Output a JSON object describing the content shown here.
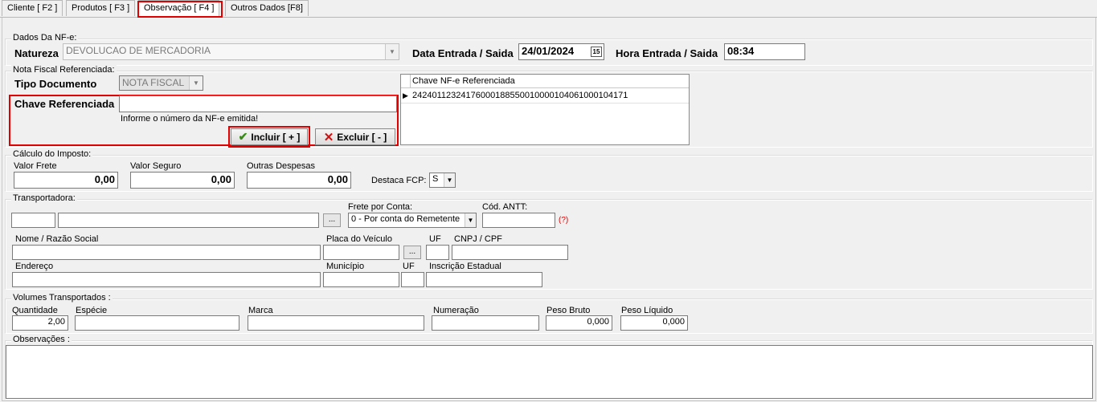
{
  "tabs": [
    {
      "label": "Cliente [ F2 ]"
    },
    {
      "label": "Produtos [ F3 ]"
    },
    {
      "label": "Observação [ F4 ]"
    },
    {
      "label": "Outros Dados [F8]"
    }
  ],
  "nfe": {
    "section_title": "Dados Da NF-e:",
    "natureza_label": "Natureza",
    "natureza_value": "DEVOLUCAO DE MERCADORIA",
    "data_label": "Data Entrada / Saida",
    "data_value": "24/01/2024",
    "calendar_glyph": "15",
    "hora_label": "Hora Entrada / Saida",
    "hora_value": "08:34"
  },
  "ref": {
    "section_title": "Nota Fiscal Referenciada:",
    "tipo_label": "Tipo Documento",
    "tipo_value": "NOTA FISCAL",
    "chave_label": "Chave Referenciada",
    "chave_value": "",
    "hint": "Informe o número da NF-e emitida!",
    "incluir_label": "Incluir [ + ]",
    "excluir_label": "Excluir [ - ]",
    "grid_header": "Chave NF-e Referenciada",
    "grid_rows": [
      "24240112324176000188550010000104061000104171"
    ]
  },
  "imposto": {
    "section_title": "Cálculo do Imposto:",
    "frete_label": "Valor Frete",
    "frete_value": "0,00",
    "seguro_label": "Valor Seguro",
    "seguro_value": "0,00",
    "outras_label": "Outras Despesas",
    "outras_value": "0,00",
    "fcp_label": "Destaca FCP:",
    "fcp_value": "S"
  },
  "transp": {
    "section_title": "Transportadora:",
    "codigo_value": "",
    "nome_value": "",
    "search_btn": "...",
    "frete_label": "Frete por Conta:",
    "frete_value": "0 - Por conta do Remetente",
    "antt_label": "Cód. ANTT:",
    "antt_value": "",
    "antt_help": "(?)",
    "razao_label": "Nome / Razão Social",
    "placa_label": "Placa do Veículo",
    "placa_btn": "...",
    "uf_label": "UF",
    "cnpj_label": "CNPJ / CPF",
    "endereco_label": "Endereço",
    "municipio_label": "Município",
    "uf2_label": "UF",
    "ie_label": "Inscrição Estadual"
  },
  "volumes": {
    "section_title": "Volumes Transportados :",
    "qtd_label": "Quantidade",
    "qtd_value": "2,00",
    "especie_label": "Espécie",
    "marca_label": "Marca",
    "numeracao_label": "Numeração",
    "peso_bruto_label": "Peso Bruto",
    "peso_bruto_value": "0,000",
    "peso_liquido_label": "Peso Líquido",
    "peso_liquido_value": "0,000"
  },
  "obs": {
    "section_title": "Observações :",
    "value": ""
  },
  "colors": {
    "highlight": "#e00000",
    "background": "#f0f0f0",
    "field_bg": "#ffffff"
  }
}
